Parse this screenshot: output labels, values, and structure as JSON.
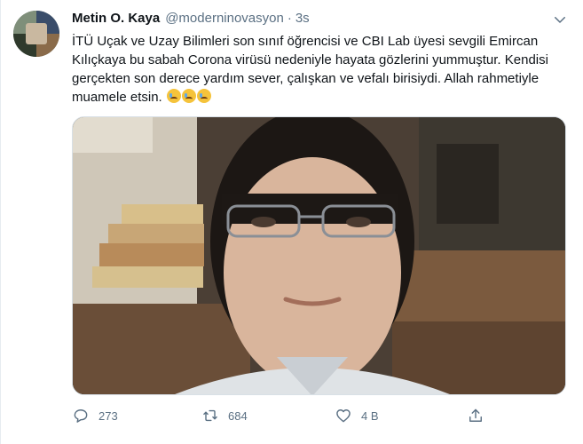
{
  "tweet": {
    "author_name": "Metin O. Kaya",
    "handle": "@moderninovasyon",
    "separator": "·",
    "time": "3s",
    "text_main": "İTÜ Uçak ve Uzay Bilimleri son sınıf öğrencisi ve CBI Lab üyesi sevgili Emircan Kılıçkaya bu sabah Corona virüsü nedeniyle hayata gözlerini yummuştur. Kendisi gerçekten son derece yardım sever, çalışkan ve vefalı birisiydi. Allah rahmetiyle muamele etsin. ",
    "emojis": [
      "crying-face-emoji",
      "crying-face-emoji",
      "crying-face-emoji"
    ]
  },
  "actions": {
    "reply_count": "273",
    "retweet_count": "684",
    "like_count": "4 B",
    "share_icon": "share-icon"
  },
  "colors": {
    "text": "#0f1419",
    "secondary": "#5b7083",
    "border": "#e6ecf0"
  }
}
